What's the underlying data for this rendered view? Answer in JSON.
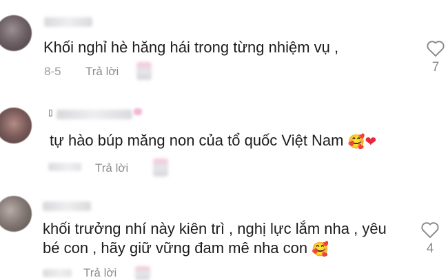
{
  "comments": [
    {
      "text": "Khối nghỉ hè hăng hái trong từng nhiệm vụ ,",
      "date": "8-5",
      "reply_label": "Trả lời",
      "likes": "7"
    },
    {
      "text": "tự hào búp măng non của tổ quốc Việt Nam",
      "emoji_face": "🥰",
      "emoji_heart": "❤",
      "reply_label": "Trả lời",
      "likes": ""
    },
    {
      "line1": "khối trưởng nhí này kiên trì , nghị lực lắm nha , yêu",
      "line2": "bé con , hãy giữ vững đam mê nha con",
      "emoji_face": "🥰",
      "reply_label": "Trả lời",
      "likes": "4"
    }
  ],
  "icons": {
    "like": "heart-outline-icon"
  },
  "colors": {
    "meta": "#9a9a9a",
    "heart_stroke": "#8a8a8a",
    "emoji_heart": "#e8293d"
  }
}
